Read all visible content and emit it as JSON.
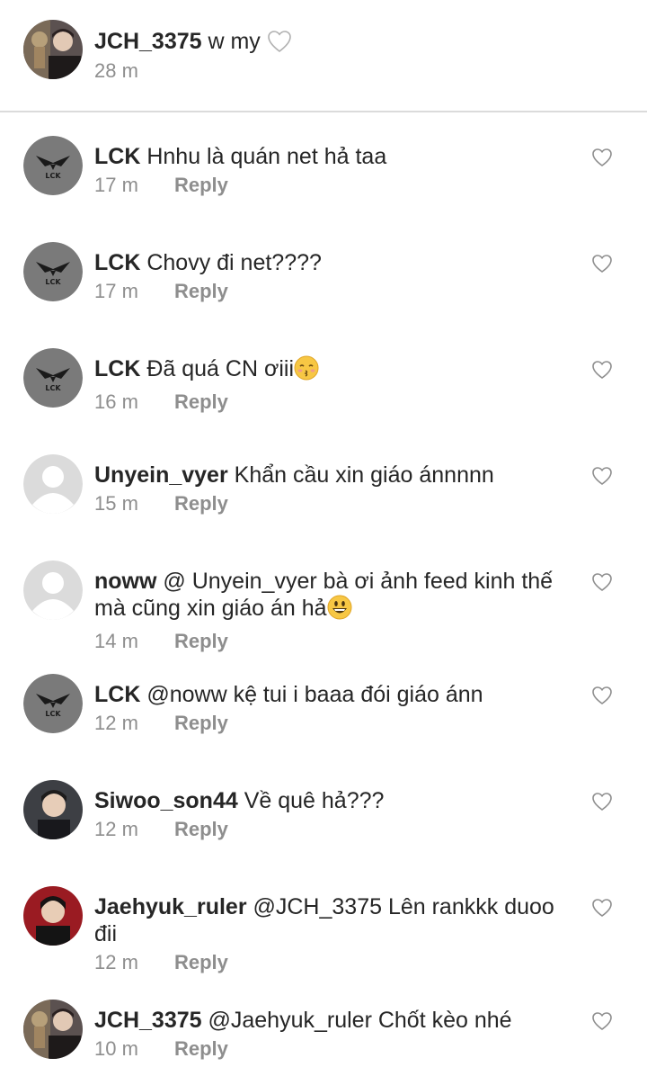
{
  "caption": {
    "username": "JCH_3375",
    "text": "w my",
    "time": "28 m"
  },
  "comments": [
    {
      "username": "LCK",
      "text": "Hnhu là quán net hả taa",
      "time": "17 m",
      "reply": "Reply",
      "avatar": "lck-logo"
    },
    {
      "username": "LCK",
      "text": "Chovy đi net????",
      "time": "17 m",
      "reply": "Reply",
      "avatar": "lck-logo"
    },
    {
      "username": "LCK",
      "text": "Đã quá CN ơiii",
      "time": "16 m",
      "reply": "Reply",
      "avatar": "lck-logo"
    },
    {
      "username": "Unyein_vyer",
      "text": "Khẩn cầu xin giáo ánnnnn",
      "time": "15 m",
      "reply": "Reply",
      "avatar": "default-avatar"
    },
    {
      "username": "noww",
      "text": "@ Unyein_vyer bà ơi ảnh feed kinh thế mà cũng xin giáo án hả",
      "time": "14 m",
      "reply": "Reply",
      "avatar": "default-avatar"
    },
    {
      "username": "LCK",
      "text": "@noww kệ tui i baaa đói giáo ánn",
      "time": "12 m",
      "reply": "Reply",
      "avatar": "lck-logo"
    },
    {
      "username": "Siwoo_son44",
      "text": "Về quê hả???",
      "time": "12 m",
      "reply": "Reply",
      "avatar": "photo-avatar"
    },
    {
      "username": "Jaehyuk_ruler",
      "text": "@JCH_3375 Lên rankkk duoo đii",
      "time": "12 m",
      "reply": "Reply",
      "avatar": "photo-avatar"
    },
    {
      "username": "JCH_3375",
      "text": "@Jaehyuk_ruler Chốt kèo nhé",
      "time": "10 m",
      "reply": "Reply",
      "avatar": "photo-avatar"
    }
  ],
  "colors": {
    "text": "#262626",
    "muted": "#8e8e8e",
    "divider": "#dbdbdb"
  },
  "icons": [
    "heart-outline-icon",
    "white-heart-emoji",
    "kissing-face-emoji",
    "grinning-face-emoji"
  ]
}
